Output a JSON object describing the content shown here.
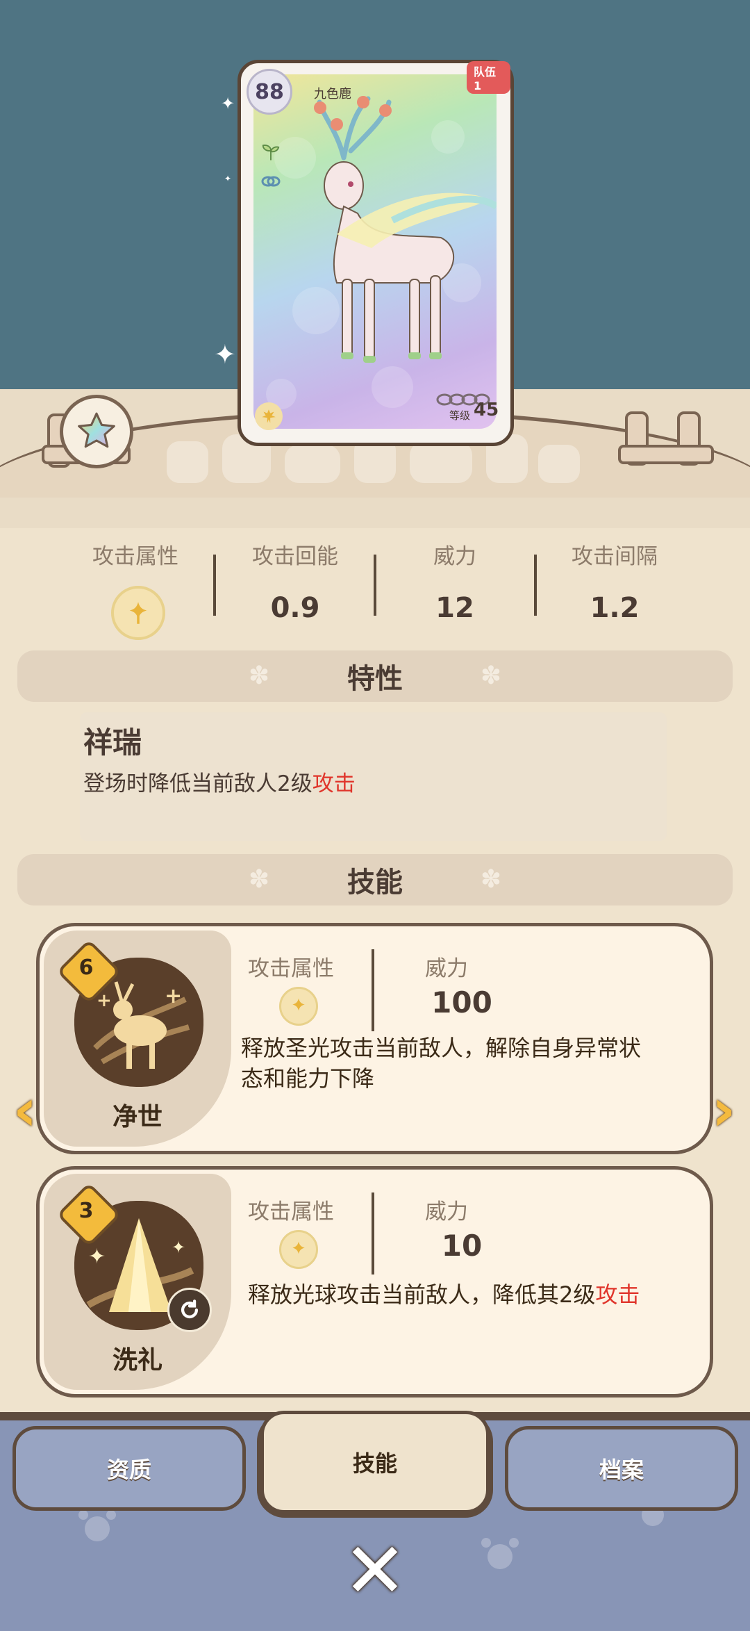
{
  "card": {
    "level": "88",
    "name": "九色鹿",
    "team_tag": "队伍1",
    "grade_label": "等级",
    "grade_value": "45"
  },
  "stats": [
    {
      "label": "攻击属性",
      "value": ""
    },
    {
      "label": "攻击回能",
      "value": "0.9"
    },
    {
      "label": "威力",
      "value": "12"
    },
    {
      "label": "攻击间隔",
      "value": "1.2"
    }
  ],
  "trait_section": {
    "title": "特性"
  },
  "trait": {
    "name": "祥瑞",
    "desc_prefix": "登场时降低当前敌人2级",
    "desc_highlight": "攻击"
  },
  "skill_section": {
    "title": "技能"
  },
  "skills": [
    {
      "cost": "6",
      "name": "净世",
      "attr_label": "攻击属性",
      "power_label": "威力",
      "power": "100",
      "desc_line1": "释放圣光攻击当前敌人，解除自身异常状",
      "desc_line2": "态和能力下降",
      "desc_highlight": ""
    },
    {
      "cost": "3",
      "name": "洗礼",
      "attr_label": "攻击属性",
      "power_label": "威力",
      "power": "10",
      "desc_line1": "释放光球攻击当前敌人，降低其2级",
      "desc_line2": "",
      "desc_highlight": "攻击"
    }
  ],
  "tabs": [
    {
      "label": "资质",
      "active": false
    },
    {
      "label": "技能",
      "active": true
    },
    {
      "label": "档案",
      "active": false
    }
  ],
  "colors": {
    "accent": "#f3bb3c",
    "highlight": "#e0352b",
    "sky": "#4f7483",
    "bottom_bar": "#8895b6"
  },
  "icons": [
    "light-element-icon",
    "sprout-icon",
    "link-icon",
    "star-icon",
    "left-arrow-icon",
    "right-arrow-icon",
    "close-icon",
    "refresh-icon"
  ]
}
